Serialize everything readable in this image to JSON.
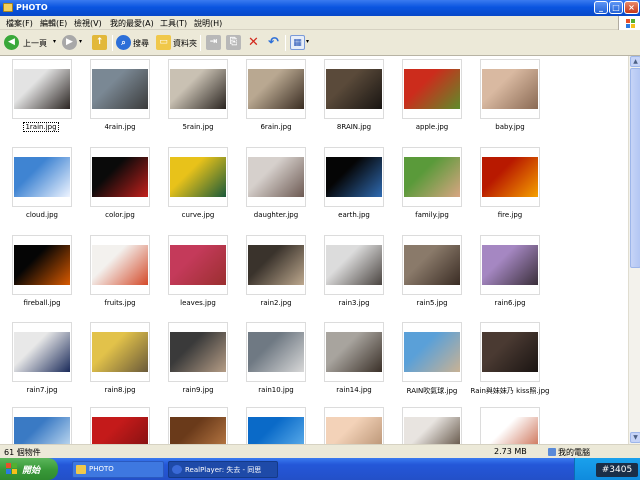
{
  "window": {
    "title": "PHOTO"
  },
  "menu": [
    "檔案(F)",
    "編輯(E)",
    "檢視(V)",
    "我的最愛(A)",
    "工具(T)",
    "說明(H)"
  ],
  "toolbar": {
    "back_label": "上一頁",
    "search_label": "搜尋",
    "folders_label": "資料夾"
  },
  "files": [
    {
      "name": "1rain.jpg",
      "selected": true,
      "colors": [
        "#e3e3e3",
        "#2b2522"
      ]
    },
    {
      "name": "4rain.jpg",
      "colors": [
        "#7a8894",
        "#3b3b3b"
      ]
    },
    {
      "name": "5rain.jpg",
      "colors": [
        "#c9c1b3",
        "#2a2420"
      ]
    },
    {
      "name": "6rain.jpg",
      "colors": [
        "#b9a891",
        "#3a2d22"
      ]
    },
    {
      "name": "8RAIN.jpg",
      "colors": [
        "#5a4a3a",
        "#191512"
      ]
    },
    {
      "name": "apple.jpg",
      "colors": [
        "#cc2c1c",
        "#5f8c2a"
      ]
    },
    {
      "name": "baby.jpg",
      "colors": [
        "#d9b9a1",
        "#8a6a54"
      ]
    },
    {
      "name": "cloud.jpg",
      "colors": [
        "#3f84d2",
        "#eef4ff"
      ]
    },
    {
      "name": "color.jpg",
      "colors": [
        "#0a0a0a",
        "#c3201c"
      ]
    },
    {
      "name": "curve.jpg",
      "colors": [
        "#e8c21a",
        "#1a5a3a"
      ]
    },
    {
      "name": "daughter.jpg",
      "colors": [
        "#d6d0cc",
        "#6d5a53"
      ]
    },
    {
      "name": "earth.jpg",
      "colors": [
        "#050505",
        "#2f6bb2"
      ]
    },
    {
      "name": "family.jpg",
      "colors": [
        "#5a9a3a",
        "#d8a582"
      ]
    },
    {
      "name": "fire.jpg",
      "colors": [
        "#b81900",
        "#f5a000"
      ]
    },
    {
      "name": "fireball.jpg",
      "colors": [
        "#050505",
        "#d95a00"
      ]
    },
    {
      "name": "fruits.jpg",
      "colors": [
        "#f3f1ee",
        "#d44a2a"
      ]
    },
    {
      "name": "leaves.jpg",
      "colors": [
        "#c43a5a",
        "#9a2f2f"
      ]
    },
    {
      "name": "rain2.jpg",
      "colors": [
        "#3a332c",
        "#bda88e"
      ]
    },
    {
      "name": "rain3.jpg",
      "colors": [
        "#dcdcdc",
        "#4a4440"
      ]
    },
    {
      "name": "rain5.jpg",
      "colors": [
        "#8a7a6a",
        "#3a2c24"
      ]
    },
    {
      "name": "rain6.jpg",
      "colors": [
        "#a587c2",
        "#3a2f3a"
      ]
    },
    {
      "name": "rain7.jpg",
      "colors": [
        "#e8e8e8",
        "#1a2a5a"
      ]
    },
    {
      "name": "rain8.jpg",
      "colors": [
        "#e2c24a",
        "#6a5a3a"
      ]
    },
    {
      "name": "rain9.jpg",
      "colors": [
        "#3a3a3a",
        "#b59d86"
      ]
    },
    {
      "name": "rain10.jpg",
      "colors": [
        "#6f7983",
        "#d8d8d8"
      ]
    },
    {
      "name": "rain14.jpg",
      "colors": [
        "#a8a49e",
        "#3a3028"
      ]
    },
    {
      "name": "RAIN吹氣球.jpg",
      "colors": [
        "#5aa0d8",
        "#c9b294"
      ]
    },
    {
      "name": "Rain與妹妹乃 kiss照.jpg",
      "colors": [
        "#4a3a32",
        "#1a1412"
      ]
    },
    {
      "name": "",
      "colors": [
        "#3a7ac4",
        "#d6eaf8"
      ]
    },
    {
      "name": "",
      "colors": [
        "#c41a1a",
        "#7a1010"
      ]
    },
    {
      "name": "",
      "colors": [
        "#6a3a1a",
        "#c4824a"
      ]
    },
    {
      "name": "",
      "colors": [
        "#0a6ac8",
        "#6ab8f0"
      ]
    },
    {
      "name": "",
      "colors": [
        "#f3d2b8",
        "#b08a6a"
      ]
    },
    {
      "name": "",
      "colors": [
        "#e8e4e0",
        "#4a3a2a"
      ]
    },
    {
      "name": "",
      "colors": [
        "#ffffff",
        "#c45a3a"
      ]
    }
  ],
  "status": {
    "objects": "61 個物件",
    "size": "2.73 MB",
    "location": "我的電腦"
  },
  "taskbar": {
    "start": "開始",
    "items": [
      "PHOTO",
      "RealPlayer: 失去 - 同思"
    ]
  },
  "watermark": "#3405"
}
